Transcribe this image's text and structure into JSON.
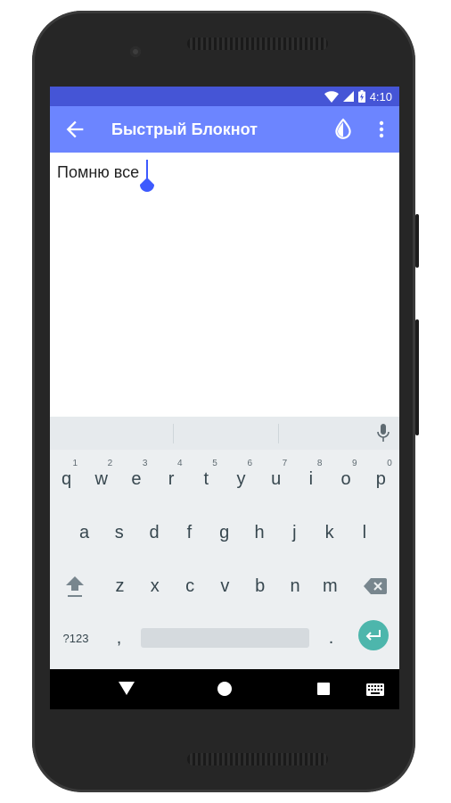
{
  "status_bar": {
    "time": "4:10"
  },
  "app_bar": {
    "title": "Быстрый Блокнот"
  },
  "editor": {
    "text": "Помню все"
  },
  "keyboard": {
    "row1": [
      {
        "key": "q",
        "hint": "1"
      },
      {
        "key": "w",
        "hint": "2"
      },
      {
        "key": "e",
        "hint": "3"
      },
      {
        "key": "r",
        "hint": "4"
      },
      {
        "key": "t",
        "hint": "5"
      },
      {
        "key": "y",
        "hint": "6"
      },
      {
        "key": "u",
        "hint": "7"
      },
      {
        "key": "i",
        "hint": "8"
      },
      {
        "key": "o",
        "hint": "9"
      },
      {
        "key": "p",
        "hint": "0"
      }
    ],
    "row2": [
      "a",
      "s",
      "d",
      "f",
      "g",
      "h",
      "j",
      "k",
      "l"
    ],
    "row3": [
      "z",
      "x",
      "c",
      "v",
      "b",
      "n",
      "m"
    ],
    "symbols_label": "?123",
    "comma": ",",
    "period": "."
  },
  "colors": {
    "app_bar": "#6c85ff",
    "status_bar": "#4555d6",
    "accent": "#3d5afe",
    "enter_key": "#4db6ac"
  },
  "icons": [
    "back-arrow-icon",
    "drop-icon",
    "more-vert-icon",
    "mic-icon",
    "shift-icon",
    "backspace-icon",
    "enter-icon",
    "nav-back-icon",
    "nav-home-icon",
    "nav-recents-icon",
    "keyboard-icon",
    "wifi-icon",
    "signal-icon",
    "battery-icon"
  ]
}
